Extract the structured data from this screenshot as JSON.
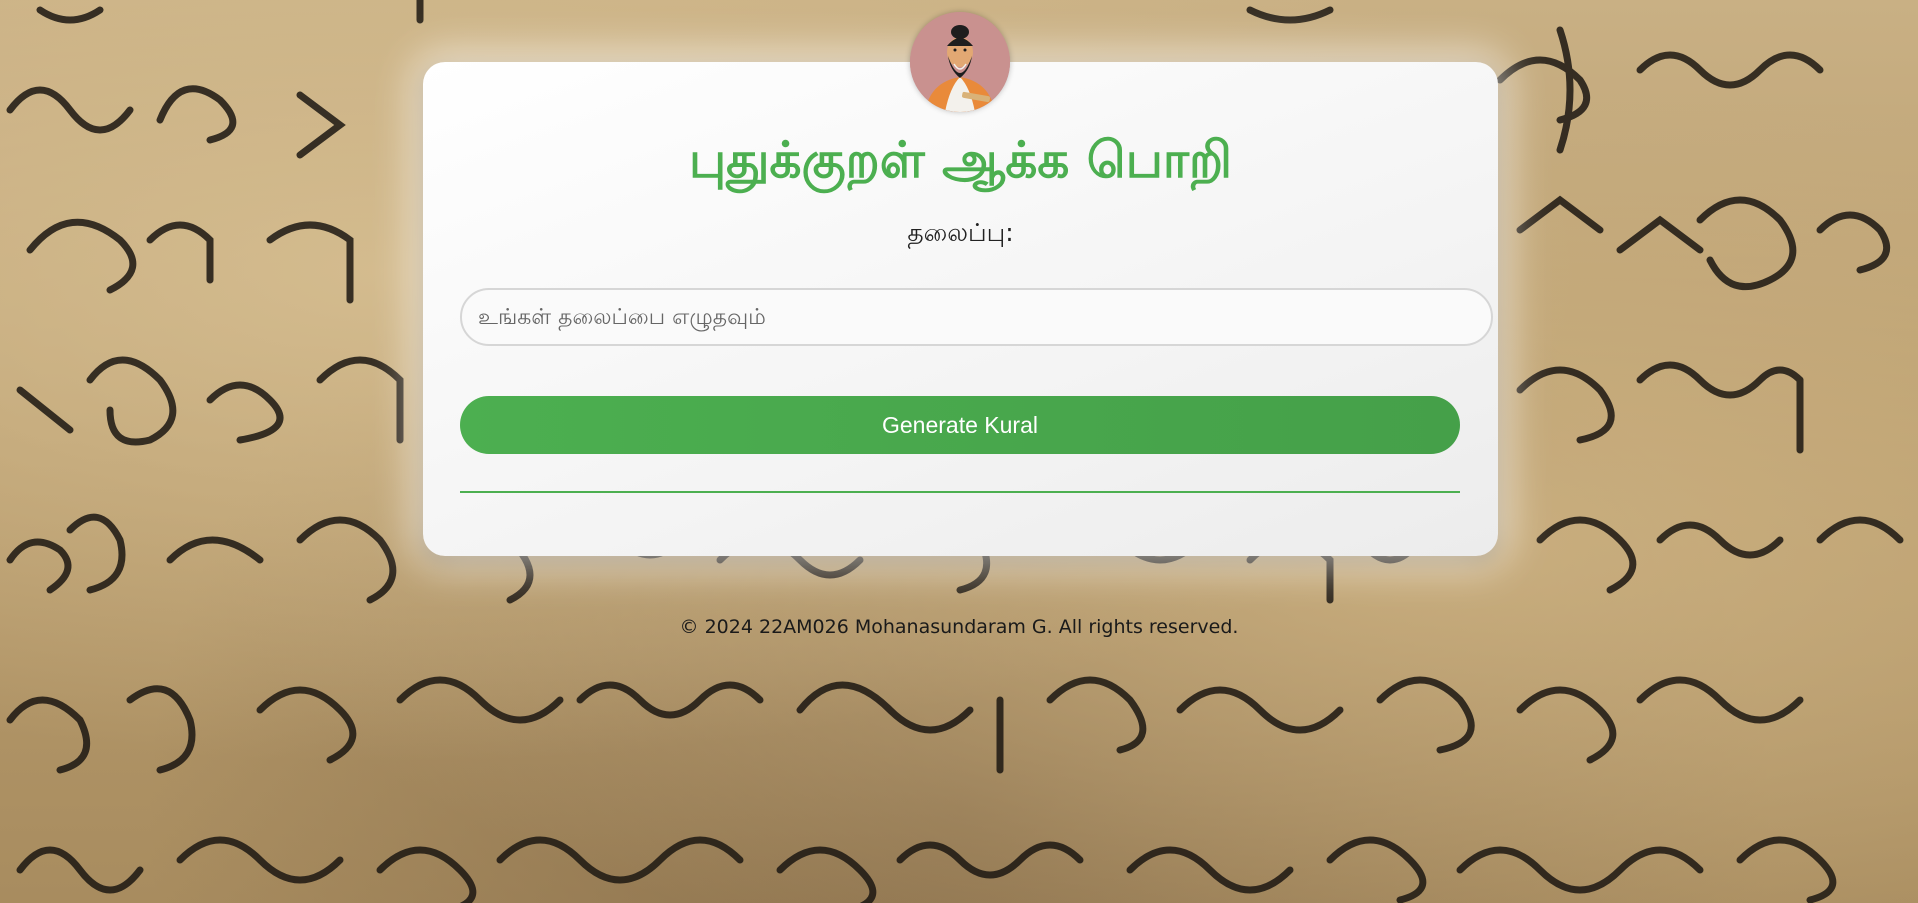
{
  "app": {
    "title": "புதுக்குறள் ஆக்க பொறி"
  },
  "form": {
    "topic_label": "தலைப்பு:",
    "topic_placeholder": "உங்கள் தலைப்பை எழுதவும்",
    "topic_value": "",
    "generate_label": "Generate Kural"
  },
  "footer": {
    "copyright": "© 2024 22AM026 Mohanasundaram G. All rights reserved."
  },
  "icons": {
    "avatar": "thiruvalluvar-portrait-icon"
  },
  "colors": {
    "accent": "#4caf50",
    "card": "#ffffff",
    "background": "#b89c6d"
  }
}
